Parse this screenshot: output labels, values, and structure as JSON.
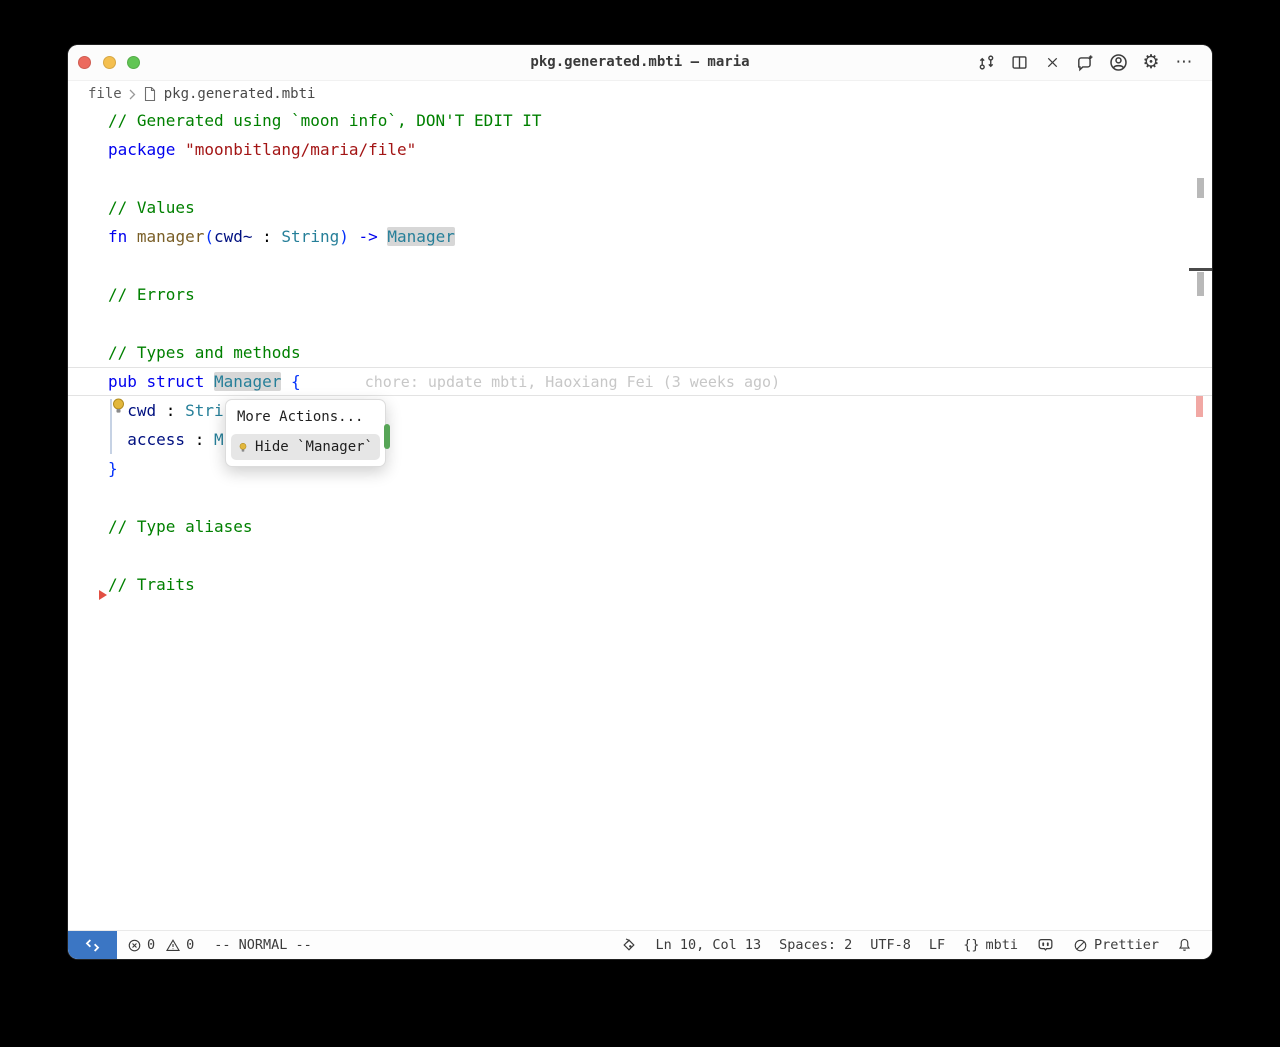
{
  "window": {
    "title": "pkg.generated.mbti — maria"
  },
  "titlebar": {
    "icons": [
      "git-sync-icon",
      "split-editor-icon",
      "close-editor-icon",
      "copilot-chat-icon",
      "account-icon",
      "settings-gear-icon",
      "more-actions-icon"
    ]
  },
  "breadcrumb": {
    "root": "file",
    "file_icon": "file-icon",
    "file": "pkg.generated.mbti"
  },
  "editor": {
    "lines": [
      {
        "tokens": [
          {
            "t": "// Generated using `moon info`, DON'T EDIT IT",
            "c": "comment"
          }
        ]
      },
      {
        "tokens": [
          {
            "t": "package",
            "c": "keyword"
          },
          {
            "t": " ",
            "c": "plain"
          },
          {
            "t": "\"moonbitlang/maria/file\"",
            "c": "string"
          }
        ]
      },
      {
        "tokens": []
      },
      {
        "tokens": [
          {
            "t": "// Values",
            "c": "comment"
          }
        ]
      },
      {
        "tokens": [
          {
            "t": "fn",
            "c": "keyword"
          },
          {
            "t": " ",
            "c": "plain"
          },
          {
            "t": "manager",
            "c": "function"
          },
          {
            "t": "(",
            "c": "bracket"
          },
          {
            "t": "cwd~",
            "c": "variable"
          },
          {
            "t": " : ",
            "c": "plain"
          },
          {
            "t": "String",
            "c": "type"
          },
          {
            "t": ")",
            "c": "bracket"
          },
          {
            "t": " ",
            "c": "plain"
          },
          {
            "t": "->",
            "c": "keyword"
          },
          {
            "t": " ",
            "c": "plain"
          },
          {
            "t": "Manager",
            "c": "type",
            "h": true
          }
        ]
      },
      {
        "tokens": []
      },
      {
        "tokens": [
          {
            "t": "// Errors",
            "c": "comment"
          }
        ]
      },
      {
        "tokens": []
      },
      {
        "tokens": [
          {
            "t": "// Types and methods",
            "c": "comment"
          }
        ]
      },
      {
        "current": true,
        "tokens": [
          {
            "t": "pub struct",
            "c": "keyword"
          },
          {
            "t": " ",
            "c": "plain"
          },
          {
            "t": "Manager",
            "c": "type",
            "h": true
          },
          {
            "t": " ",
            "c": "plain"
          },
          {
            "t": "{",
            "c": "bracket"
          },
          {
            "t": "chore: update mbti, Haoxiang Fei (3 weeks ago)",
            "c": "blame"
          }
        ]
      },
      {
        "tokens": [
          {
            "t": "  ",
            "c": "plain"
          },
          {
            "t": "cwd",
            "c": "variable"
          },
          {
            "t": " : ",
            "c": "plain"
          },
          {
            "t": "Stri",
            "c": "type"
          }
        ]
      },
      {
        "tokens": [
          {
            "t": "  ",
            "c": "plain"
          },
          {
            "t": "access",
            "c": "variable"
          },
          {
            "t": " : ",
            "c": "plain"
          },
          {
            "t": "M",
            "c": "type"
          }
        ]
      },
      {
        "tokens": [
          {
            "t": "}",
            "c": "bracket"
          }
        ]
      },
      {
        "tokens": []
      },
      {
        "tokens": [
          {
            "t": "// Type aliases",
            "c": "comment"
          }
        ]
      },
      {
        "tokens": []
      },
      {
        "tokens": [
          {
            "t": "// Traits",
            "c": "comment"
          }
        ]
      }
    ],
    "blame": "chore: update mbti, Haoxiang Fei (3 weeks ago)",
    "popup": {
      "header": "More Actions...",
      "items": [
        {
          "icon": "lightbulb-icon",
          "label": "Hide `Manager`",
          "selected": true
        }
      ]
    },
    "margin_icon": "lightbulb-icon"
  },
  "status_bar": {
    "remote_icon": "remote-icon",
    "problems": {
      "error_icon": "error-icon",
      "errors": "0",
      "warning_icon": "warning-icon",
      "warnings": "0"
    },
    "vim_mode": "-- NORMAL --",
    "ink_icon": "ink-bottle-icon",
    "cursor": "Ln 10, Col 13",
    "indentation": "Spaces: 2",
    "encoding": "UTF-8",
    "eol": "LF",
    "language_prefix": "{}",
    "language": "mbti",
    "copilot_icon": "copilot-icon",
    "formatter_icon": "circle-slash-icon",
    "formatter": "Prettier",
    "bell_icon": "bell-icon"
  },
  "colors": {
    "remote_accent": "#3b76c4",
    "comment": "#008000",
    "keyword": "#0000ee",
    "string": "#a31515",
    "function": "#795e26",
    "variable": "#001080",
    "type": "#267f99",
    "bracket": "#0431fa",
    "blame_text": "#c7c7c7",
    "word_highlight_bg": "#d7d7d7",
    "popup_selected_bg": "#e6e6e6",
    "lightbulb": "#e2b73d",
    "green_mark": "#57a557",
    "ruler_salmon": "#f1a8a4",
    "traffic_red": "#ec6a5e",
    "traffic_yellow": "#f4bf4f",
    "traffic_green": "#61c554"
  }
}
